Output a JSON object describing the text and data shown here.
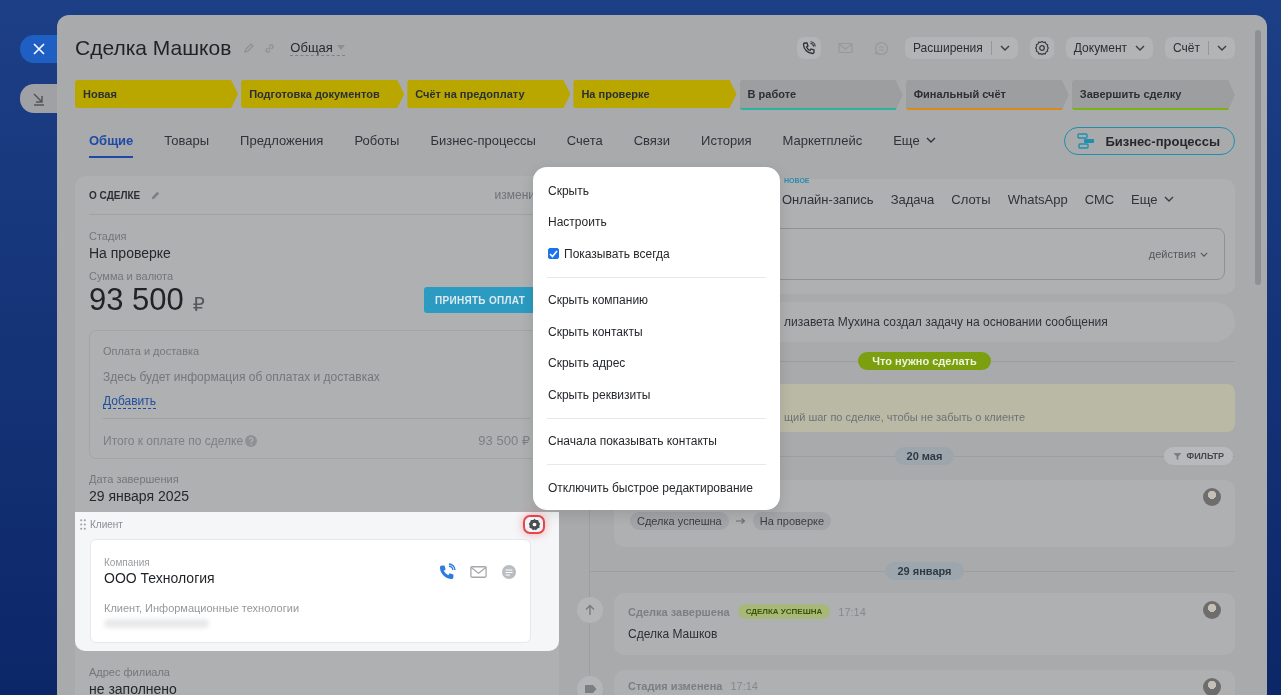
{
  "header": {
    "title": "Сделка Машков",
    "category": "Общая"
  },
  "contact_buttons": [
    {
      "disabled": false
    },
    {
      "disabled": true
    },
    {
      "disabled": true
    }
  ],
  "menus": [
    {
      "label": "Расширения",
      "split": true
    },
    {
      "label": "Документ",
      "split": false
    },
    {
      "label": "Счёт",
      "split": true
    }
  ],
  "stages": [
    {
      "label": "Новая",
      "color": "#b9a700",
      "reached": true
    },
    {
      "label": "Подготовка документов",
      "color": "#b9a700",
      "reached": true
    },
    {
      "label": "Счёт на предоплату",
      "color": "#b9a700",
      "reached": true
    },
    {
      "label": "На проверке",
      "color": "#b9a700",
      "reached": true
    },
    {
      "label": "В работе",
      "color": "#2bb3a0",
      "reached": false
    },
    {
      "label": "Финальный счёт",
      "color": "#d98a1c",
      "reached": false
    },
    {
      "label": "Завершить сделку",
      "color": "#7ab317",
      "reached": false
    }
  ],
  "tabs": [
    {
      "label": "Общие",
      "selected": true,
      "kind": "tab"
    },
    {
      "label": "Товары",
      "selected": false,
      "kind": "tab"
    },
    {
      "label": "Предложения",
      "selected": false,
      "kind": "tab"
    },
    {
      "label": "Роботы",
      "selected": false,
      "kind": "tab"
    },
    {
      "label": "Бизнес-процессы",
      "selected": false,
      "kind": "tab"
    },
    {
      "label": "Счета",
      "selected": false,
      "kind": "tab"
    },
    {
      "label": "Связи",
      "selected": false,
      "kind": "tab"
    },
    {
      "label": "История",
      "selected": false,
      "kind": "tab"
    },
    {
      "label": "Маркетплейс",
      "selected": false,
      "kind": "tab"
    },
    {
      "label": "Еще",
      "selected": false,
      "kind": "dropdown"
    }
  ],
  "process_button": {
    "label": "Бизнес-процессы"
  },
  "deal": {
    "title": "О СДЕЛКЕ",
    "edit_link": "измени",
    "stage": {
      "label": "Стадия",
      "value": "На проверке"
    },
    "amount": {
      "label": "Сумма и валюта",
      "value": "93 500",
      "currency": "₽",
      "pay_button": "ПРИНЯТЬ ОПЛАТ"
    },
    "payment": {
      "title": "Оплата и доставка",
      "note": "Здесь будет информация об оплатах и доставках",
      "add_link": "Добавить",
      "total_label": "Итого к оплате по сделке",
      "total_value": "93 500 ₽"
    },
    "close_date": {
      "label": "Дата завершения",
      "value": "29 января 2025"
    },
    "client": {
      "title": "Клиент",
      "company_label": "Компания",
      "company": "ООО Технология",
      "description": "Клиент, Информационные технологии"
    },
    "branch": {
      "label": "Адрес филиала",
      "value": "не заполнено"
    }
  },
  "context_menu": {
    "groups": [
      [
        {
          "label": "Скрыть",
          "kind": "action"
        },
        {
          "label": "Настроить",
          "kind": "action"
        },
        {
          "label": "Показывать всегда",
          "kind": "checkbox",
          "checked": true
        }
      ],
      [
        {
          "label": "Скрыть компанию",
          "kind": "action"
        },
        {
          "label": "Скрыть контакты",
          "kind": "action"
        },
        {
          "label": "Скрыть адрес",
          "kind": "action"
        },
        {
          "label": "Скрыть реквизиты",
          "kind": "action"
        }
      ],
      [
        {
          "label": "Сначала показывать контакты",
          "kind": "action"
        }
      ],
      [
        {
          "label": "Отключить быстрое редактирование",
          "kind": "action"
        }
      ]
    ]
  },
  "composer": {
    "badge": "НОВОЕ",
    "tabs": [
      "Онлайн-запись",
      "Задача",
      "Слоты",
      "WhatsApp",
      "СМС"
    ],
    "more": "Еще",
    "actions": "действия"
  },
  "timeline": {
    "note": "лизавета Мухина создал задачу на основании сообщения",
    "todo_label": "Что нужно сделать",
    "reminder": "щий шаг по сделке, чтобы не забыть о клиенте",
    "days": [
      {
        "date": "20 мая",
        "filter": "ФИЛЬТР",
        "events": [
          {
            "kind": "stage_change",
            "from": "Сделка успешна",
            "to": "На проверке"
          }
        ]
      },
      {
        "date": "29 января",
        "events": [
          {
            "kind": "completed",
            "title": "Сделка завершена",
            "badge": "СДЕЛКА УСПЕШНА",
            "time": "17:14",
            "text": "Сделка Машков"
          },
          {
            "kind": "stage",
            "title": "Стадия изменена",
            "time": "17:14"
          }
        ]
      }
    ]
  }
}
